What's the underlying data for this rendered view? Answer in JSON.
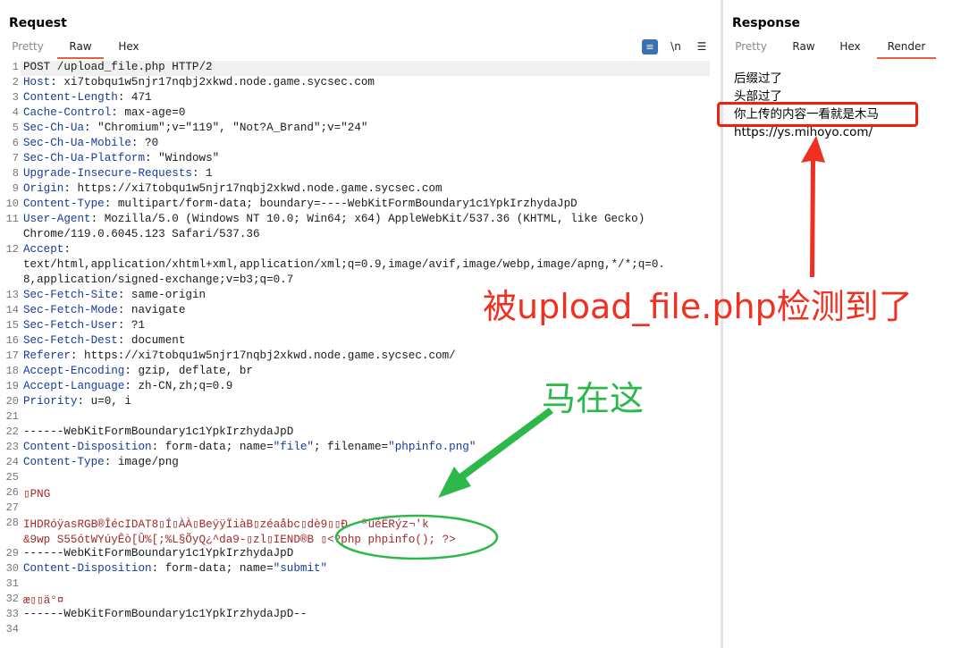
{
  "request": {
    "title": "Request",
    "tabs": [
      "Pretty",
      "Raw",
      "Hex"
    ],
    "active_tab": "Raw",
    "tools": {
      "wrap_icon": "wrap-lines-icon",
      "newline_label": "\\n",
      "menu_icon": "hamburger-menu-icon"
    },
    "lines": [
      {
        "n": "1",
        "parts": [
          {
            "t": "POST /upload_file.php HTTP/2",
            "c": ""
          }
        ]
      },
      {
        "n": "2",
        "parts": [
          {
            "t": "Host",
            "c": "hdr"
          },
          {
            "t": ": xi7tobqu1w5njr17nqbj2xkwd.node.game.sycsec.com",
            "c": ""
          }
        ]
      },
      {
        "n": "3",
        "parts": [
          {
            "t": "Content-Length",
            "c": "hdr"
          },
          {
            "t": ": 471",
            "c": ""
          }
        ]
      },
      {
        "n": "4",
        "parts": [
          {
            "t": "Cache-Control",
            "c": "hdr"
          },
          {
            "t": ": max-age=0",
            "c": ""
          }
        ]
      },
      {
        "n": "5",
        "parts": [
          {
            "t": "Sec-Ch-Ua",
            "c": "hdr"
          },
          {
            "t": ": \"Chromium\";v=\"119\", \"Not?A_Brand\";v=\"24\"",
            "c": ""
          }
        ]
      },
      {
        "n": "6",
        "parts": [
          {
            "t": "Sec-Ch-Ua-Mobile",
            "c": "hdr"
          },
          {
            "t": ": ?0",
            "c": ""
          }
        ]
      },
      {
        "n": "7",
        "parts": [
          {
            "t": "Sec-Ch-Ua-Platform",
            "c": "hdr"
          },
          {
            "t": ": \"Windows\"",
            "c": ""
          }
        ]
      },
      {
        "n": "8",
        "parts": [
          {
            "t": "Upgrade-Insecure-Requests",
            "c": "hdr"
          },
          {
            "t": ": 1",
            "c": ""
          }
        ]
      },
      {
        "n": "9",
        "parts": [
          {
            "t": "Origin",
            "c": "hdr"
          },
          {
            "t": ": https://xi7tobqu1w5njr17nqbj2xkwd.node.game.sycsec.com",
            "c": ""
          }
        ]
      },
      {
        "n": "10",
        "parts": [
          {
            "t": "Content-Type",
            "c": "hdr"
          },
          {
            "t": ": multipart/form-data; boundary=----WebKitFormBoundary1c1YpkIrzhydaJpD",
            "c": ""
          }
        ]
      },
      {
        "n": "11",
        "parts": [
          {
            "t": "User-Agent",
            "c": "hdr"
          },
          {
            "t": ": Mozilla/5.0 (Windows NT 10.0; Win64; x64) AppleWebKit/537.36 (KHTML, like Gecko)",
            "c": ""
          }
        ]
      },
      {
        "n": "",
        "parts": [
          {
            "t": "Chrome/119.0.6045.123 Safari/537.36",
            "c": ""
          }
        ]
      },
      {
        "n": "12",
        "parts": [
          {
            "t": "Accept",
            "c": "hdr"
          },
          {
            "t": ":",
            "c": ""
          }
        ]
      },
      {
        "n": "",
        "parts": [
          {
            "t": "text/html,application/xhtml+xml,application/xml;q=0.9,image/avif,image/webp,image/apng,*/*;q=0.",
            "c": ""
          }
        ]
      },
      {
        "n": "",
        "parts": [
          {
            "t": "8,application/signed-exchange;v=b3;q=0.7",
            "c": ""
          }
        ]
      },
      {
        "n": "13",
        "parts": [
          {
            "t": "Sec-Fetch-Site",
            "c": "hdr"
          },
          {
            "t": ": same-origin",
            "c": ""
          }
        ]
      },
      {
        "n": "14",
        "parts": [
          {
            "t": "Sec-Fetch-Mode",
            "c": "hdr"
          },
          {
            "t": ": navigate",
            "c": ""
          }
        ]
      },
      {
        "n": "15",
        "parts": [
          {
            "t": "Sec-Fetch-User",
            "c": "hdr"
          },
          {
            "t": ": ?1",
            "c": ""
          }
        ]
      },
      {
        "n": "16",
        "parts": [
          {
            "t": "Sec-Fetch-Dest",
            "c": "hdr"
          },
          {
            "t": ": document",
            "c": ""
          }
        ]
      },
      {
        "n": "17",
        "parts": [
          {
            "t": "Referer",
            "c": "hdr"
          },
          {
            "t": ": https://xi7tobqu1w5njr17nqbj2xkwd.node.game.sycsec.com/",
            "c": ""
          }
        ]
      },
      {
        "n": "18",
        "parts": [
          {
            "t": "Accept-Encoding",
            "c": "hdr"
          },
          {
            "t": ": gzip, deflate, br",
            "c": ""
          }
        ]
      },
      {
        "n": "19",
        "parts": [
          {
            "t": "Accept-Language",
            "c": "hdr"
          },
          {
            "t": ": zh-CN,zh;q=0.9",
            "c": ""
          }
        ]
      },
      {
        "n": "20",
        "parts": [
          {
            "t": "Priority",
            "c": "hdr"
          },
          {
            "t": ": u=0, i",
            "c": ""
          }
        ]
      },
      {
        "n": "21",
        "parts": [
          {
            "t": "",
            "c": ""
          }
        ]
      },
      {
        "n": "22",
        "parts": [
          {
            "t": "------WebKitFormBoundary1c1YpkIrzhydaJpD",
            "c": ""
          }
        ]
      },
      {
        "n": "23",
        "parts": [
          {
            "t": "Content-Disposition",
            "c": "hdr"
          },
          {
            "t": ": form-data; name=",
            "c": ""
          },
          {
            "t": "\"file\"",
            "c": "str"
          },
          {
            "t": "; filename=",
            "c": ""
          },
          {
            "t": "\"phpinfo.png\"",
            "c": "str"
          }
        ]
      },
      {
        "n": "24",
        "parts": [
          {
            "t": "Content-Type",
            "c": "hdr"
          },
          {
            "t": ": image/png",
            "c": ""
          }
        ]
      },
      {
        "n": "25",
        "parts": [
          {
            "t": "",
            "c": ""
          }
        ]
      },
      {
        "n": "26",
        "parts": [
          {
            "t": "▯PNG",
            "c": "bin"
          }
        ]
      },
      {
        "n": "27",
        "parts": [
          {
            "t": "",
            "c": ""
          }
        ]
      },
      {
        "n": "28",
        "parts": [
          {
            "t": "IHDRóÿasRGB®ÎécIDAT8▯Í▯ÀÀ▯BeÿÿÏiàB▯zéaåbc▯dè9▯▯Ð  ªúéËRýz¬'k",
            "c": "bin"
          }
        ]
      },
      {
        "n": "",
        "parts": [
          {
            "t": "&9wp S55ótWYúyÊò[Û%[;%L§ÕyQ¿^da9-▯zl▯IEND®B ▯",
            "c": "bin"
          },
          {
            "t": "<?php phpinfo(); ?>",
            "c": "bin"
          }
        ]
      },
      {
        "n": "29",
        "parts": [
          {
            "t": "------WebKitFormBoundary1c1YpkIrzhydaJpD",
            "c": ""
          }
        ]
      },
      {
        "n": "30",
        "parts": [
          {
            "t": "Content-Disposition",
            "c": "hdr"
          },
          {
            "t": ": form-data; name=",
            "c": ""
          },
          {
            "t": "\"submit\"",
            "c": "str"
          }
        ]
      },
      {
        "n": "31",
        "parts": [
          {
            "t": "",
            "c": ""
          }
        ]
      },
      {
        "n": "32",
        "parts": [
          {
            "t": "æ▯▯ä°¤",
            "c": "bin"
          }
        ]
      },
      {
        "n": "33",
        "parts": [
          {
            "t": "------WebKitFormBoundary1c1YpkIrzhydaJpD--",
            "c": ""
          }
        ]
      },
      {
        "n": "34",
        "parts": [
          {
            "t": "",
            "c": ""
          }
        ]
      }
    ]
  },
  "response": {
    "title": "Response",
    "tabs": [
      "Pretty",
      "Raw",
      "Hex",
      "Render"
    ],
    "active_tab": "Render",
    "rendered_lines": [
      "后缀过了",
      "头部过了",
      "你上传的内容一看就是木马",
      "https://ys.mihoyo.com/"
    ]
  },
  "annotations": {
    "red_text": "被upload_file.php检测到了",
    "green_text": "马在这",
    "red_color": "#f03020",
    "green_color": "#2db84a"
  },
  "colors": {
    "accent": "#e8613c",
    "header_key": "#153b9c",
    "binary": "#a22a2a"
  }
}
